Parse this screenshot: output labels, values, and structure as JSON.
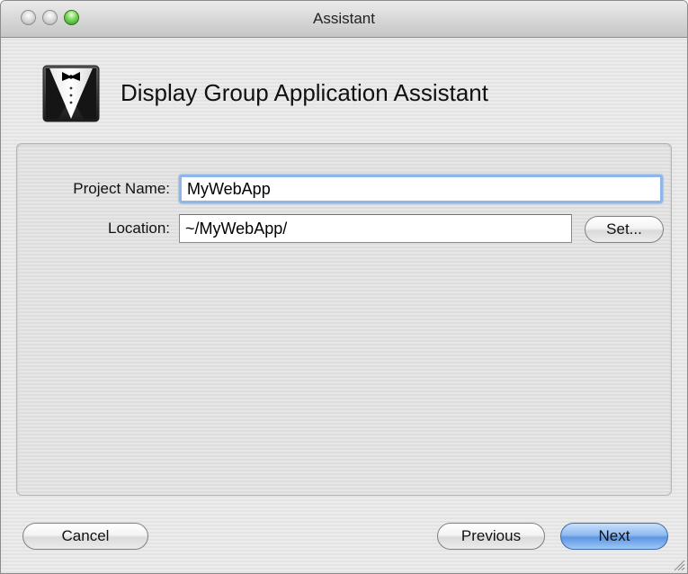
{
  "window": {
    "title": "Assistant"
  },
  "header": {
    "title": "Display Group Application Assistant",
    "icon": "tuxedo-icon"
  },
  "form": {
    "project_name_label": "Project Name:",
    "project_name_value": "MyWebApp",
    "location_label": "Location:",
    "location_value": "~/MyWebApp/",
    "set_button_label": "Set..."
  },
  "footer": {
    "cancel_label": "Cancel",
    "previous_label": "Previous",
    "next_label": "Next"
  },
  "colors": {
    "focus_ring": "#8fb6e8",
    "default_button": "#5e96e3",
    "zoom_button": "#2f9a1b"
  }
}
